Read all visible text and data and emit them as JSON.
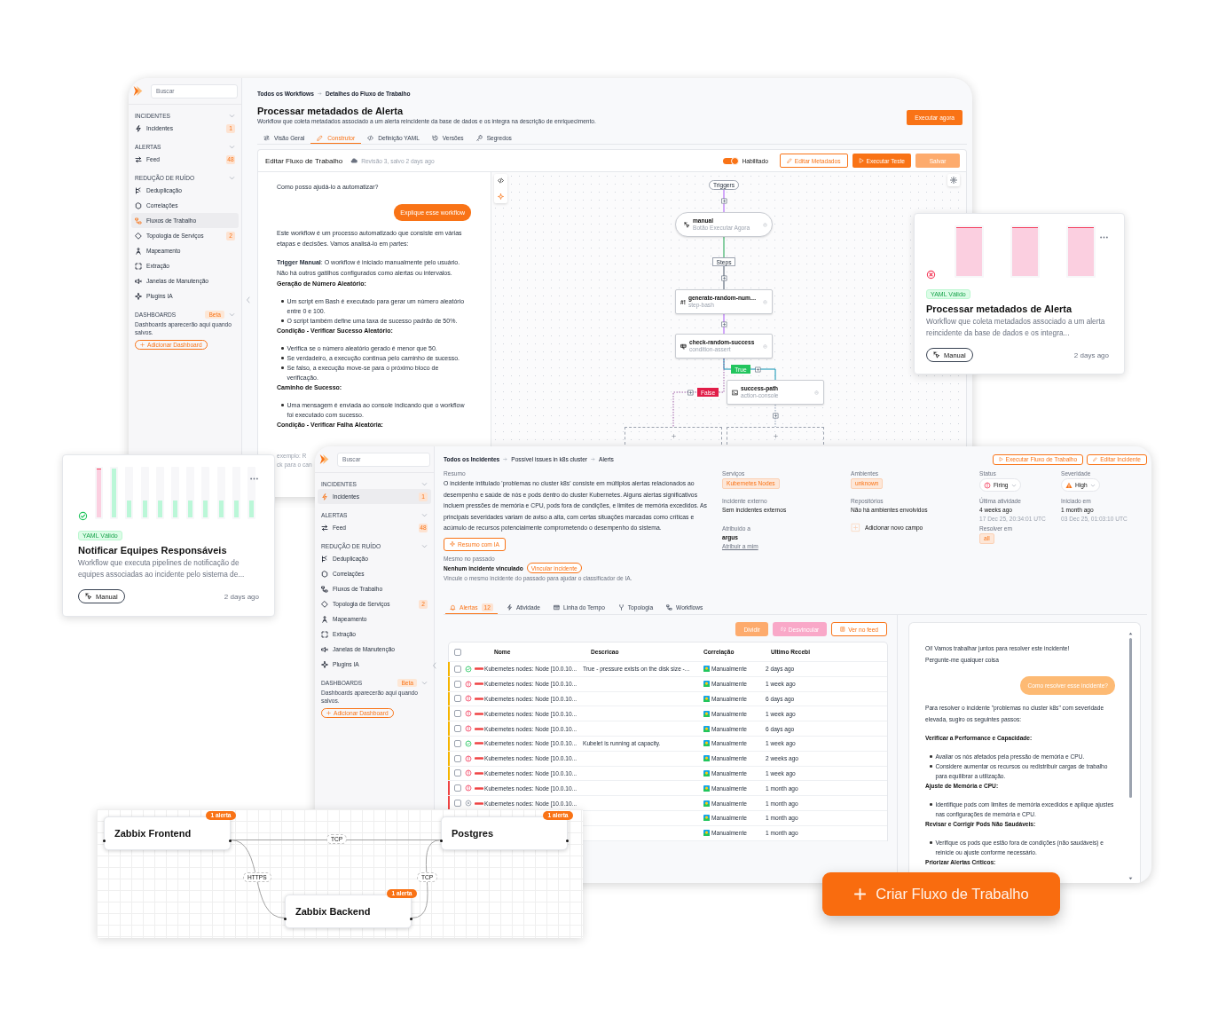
{
  "windows": [
    {
      "kind": "workflow_editor",
      "sidebar": {
        "search": {
          "placeholder": "Buscar"
        },
        "sections": [
          {
            "title": "INCIDENTES",
            "items": [
              {
                "label": "Incidentes",
                "badge": "1",
                "selected": false
              }
            ]
          },
          {
            "title": "ALERTAS",
            "items": [
              {
                "label": "Feed",
                "badge": "48",
                "selected": false
              }
            ]
          },
          {
            "title": "REDUÇÃO DE RUÍDO",
            "items": [
              {
                "label": "Deduplicação",
                "selected": false
              },
              {
                "label": "Correlações",
                "selected": false
              },
              {
                "label": "Fluxos de Trabalho",
                "selected": true
              },
              {
                "label": "Topologia de Serviços",
                "badge": "2",
                "selected": false
              },
              {
                "label": "Mapeamento",
                "selected": false
              },
              {
                "label": "Extração",
                "selected": false
              },
              {
                "label": "Janelas de Manutenção",
                "selected": false
              },
              {
                "label": "Plugins IA",
                "selected": false
              }
            ]
          },
          {
            "title": "DASHBOARDS",
            "badge": "Beta",
            "note": "Dashboards aparecerão aqui quando salvos.",
            "button": "Adicionar Dashboard"
          }
        ]
      },
      "breadcrumb": [
        "Todos os Workflows",
        "Detalhes do Fluxo de Trabalho"
      ],
      "title": "Processar metadados de Alerta",
      "description": "Workflow que coleta metadados associado a um alerta reincidente da base de dados e os integra na descrição de enriquecimento.",
      "primary_button": "Executar agora",
      "tabs": [
        {
          "label": "Visão Geral",
          "selected": false
        },
        {
          "label": "Construtor",
          "selected": true
        },
        {
          "label": "Definição YAML",
          "selected": false
        },
        {
          "label": "Versões",
          "selected": false
        },
        {
          "label": "Segredos",
          "selected": false
        }
      ],
      "editor": {
        "title": "Editar Fluxo de Trabalho",
        "revision": "Revisão 3, salvo 2 days ago",
        "toggle": {
          "label": "Habilitado",
          "on": true
        },
        "buttons": [
          {
            "label": "Editar Metadados",
            "kind": "outline"
          },
          {
            "label": "Executar Teste",
            "kind": "primary"
          },
          {
            "label": "Salvar",
            "kind": "soft"
          }
        ]
      },
      "chat": {
        "greeting": "Como posso ajudá-lo a automatizar?",
        "user_message": "Explique esse workflow",
        "reply": [
          {
            "kind": "paragraph",
            "text": "Este workflow é um processo automatizado que consiste em várias etapas e decisões. Vamos analisá-lo em partes:"
          },
          {
            "kind": "paragraph",
            "text": "**Trigger Manual**: O workflow é iniciado manualmente pelo usuário. Não há outros gatilhos configurados como alertas ou intervalos."
          },
          {
            "kind": "heading",
            "text": "Geração de Número Aleatório:"
          },
          {
            "kind": "list",
            "items": [
              "Um script em Bash é executado para gerar um número aleatório entre 0 e 100.",
              "O script também define uma taxa de sucesso padrão de 50%."
            ]
          },
          {
            "kind": "heading",
            "text": "Condição - Verificar Sucesso Aleatório:"
          },
          {
            "kind": "list",
            "items": [
              "Verifica se o número aleatório gerado é menor que 50.",
              "Se verdadeiro, a execução continua pelo caminho de sucesso.",
              "Se falso, a execução move-se para o próximo bloco de verificação."
            ]
          },
          {
            "kind": "heading",
            "text": "Caminho de Sucesso:"
          },
          {
            "kind": "list",
            "items": [
              "Uma mensagem é enviada ao console indicando que o workflow foi executado com sucesso."
            ]
          },
          {
            "kind": "heading",
            "text": "Condição - Verificar Falha Aleatória:"
          }
        ],
        "input": {
          "placeholder": "exemplo: R",
          "hint": "ck para o can"
        }
      },
      "canvas": {
        "labels": [
          {
            "text": "Triggers",
            "kind": "pill"
          },
          {
            "text": "Steps",
            "kind": "tag"
          },
          {
            "text": "True",
            "kind": "true"
          },
          {
            "text": "False",
            "kind": "false"
          }
        ],
        "nodes": [
          {
            "name": "manual",
            "type": "Botão Executar Agora",
            "kind": "trigger"
          },
          {
            "name": "generate-random-num…",
            "type": "step-bash",
            "kind": "step",
            "glyph": "#!"
          },
          {
            "name": "check-random-success",
            "type": "condition-assert",
            "kind": "condition"
          },
          {
            "name": "success-path",
            "type": "action-console",
            "kind": "action"
          }
        ]
      }
    },
    {
      "kind": "incident",
      "sidebar": {
        "search": {
          "placeholder": "Buscar"
        },
        "sections": [
          {
            "title": "INCIDENTES",
            "items": [
              {
                "label": "Incidentes",
                "badge": "1",
                "selected": true
              }
            ]
          },
          {
            "title": "ALERTAS",
            "items": [
              {
                "label": "Feed",
                "badge": "48",
                "selected": false
              }
            ]
          },
          {
            "title": "REDUÇÃO DE RUÍDO",
            "items": [
              {
                "label": "Deduplicação",
                "selected": false
              },
              {
                "label": "Correlações",
                "selected": false
              },
              {
                "label": "Fluxos de Trabalho",
                "selected": false
              },
              {
                "label": "Topologia de Serviços",
                "badge": "2",
                "selected": false
              },
              {
                "label": "Mapeamento",
                "selected": false
              },
              {
                "label": "Extração",
                "selected": false
              },
              {
                "label": "Janelas de Manutenção",
                "selected": false
              },
              {
                "label": "Plugins IA",
                "selected": false
              }
            ]
          },
          {
            "title": "DASHBOARDS",
            "badge": "Beta",
            "note": "Dashboards aparecerão aqui quando salvos.",
            "button": "Adicionar Dashboard"
          }
        ]
      },
      "breadcrumb": [
        "Todos os Incidentes",
        "Possível issues in k8s cluster",
        "Alerts"
      ],
      "header_buttons": [
        {
          "label": "Executar Fluxo de Trabalho",
          "kind": "run"
        },
        {
          "label": "Editar Incidente",
          "kind": "edit"
        }
      ],
      "summary": {
        "label": "Resumo",
        "text": "O incidente intitulado 'problemas no cluster k8s' consiste em múltiplos alertas relacionados ao desempenho e saúde de nós e pods dentro do cluster Kubernetes. Alguns alertas significativos incluem pressões de memória e CPU, pods fora de condições, e limites de memória excedidos. As principais severidades variam de aviso a alta, com certas situações marcadas como críticas e acúmulo de recursos potencialmente comprometendo o desempenho do sistema.",
        "button": "Resumo com IA"
      },
      "similar": {
        "label": "Mesmo no passado",
        "value": "Nenhum incidente vinculado",
        "button": "Vincular incidente",
        "hint": "Vincule o mesmo incidente do passado para ajudar o classificador de IA."
      },
      "details": [
        [
          {
            "kind": "tag",
            "label": "Serviços",
            "value": "Kubernetes Nodes"
          },
          {
            "kind": "text",
            "label": "Incidente externo",
            "value": "Sem incidentes externos"
          },
          {
            "kind": "assignee",
            "label": "Atribuído a",
            "value": "argus",
            "link": "Atribuir a mim"
          }
        ],
        [
          {
            "kind": "tag",
            "label": "Ambientes",
            "value": "unknown"
          },
          {
            "kind": "text",
            "label": "Repositórios",
            "value": "Não há ambientes envolvidos"
          },
          {
            "kind": "add",
            "value": "Adicionar novo campo"
          }
        ],
        [
          {
            "kind": "status",
            "label": "Status",
            "value": "Firing"
          },
          {
            "kind": "time",
            "label": "Última atividade",
            "value": "4 weeks ago",
            "detail": "17 Dec 25, 20:34:01 UTC"
          },
          {
            "kind": "tag",
            "label": "Resolver em",
            "value": "all"
          }
        ],
        [
          {
            "kind": "severity",
            "label": "Severidade",
            "value": "High"
          },
          {
            "kind": "time",
            "label": "Iniciado em",
            "value": "1 month ago",
            "detail": "03 Dec 25, 01:03:10 UTC"
          }
        ]
      ],
      "tabs": [
        {
          "label": "Alertas",
          "count": "12",
          "selected": true
        },
        {
          "label": "Atividade",
          "selected": false
        },
        {
          "label": "Linha do Tempo",
          "selected": false
        },
        {
          "label": "Topologia",
          "selected": false
        },
        {
          "label": "Workflows",
          "selected": false
        }
      ],
      "table_actions": [
        {
          "label": "Dividir",
          "kind": "soft"
        },
        {
          "label": "Desvincular",
          "kind": "pink"
        },
        {
          "label": "Ver no feed",
          "kind": "outline"
        }
      ],
      "table": {
        "checked": false,
        "columns": [
          "Nome",
          "Descricao",
          "Correlação",
          "Ultimo Recebi"
        ],
        "rows": [
          {
            "checked": false,
            "kind": "resolved",
            "color": "#f5b400",
            "name": "Kubernetes nodes: Node [10.0.10...",
            "description": "True - pressure exists on the disk size -...",
            "correlation": "Manualmente",
            "received": "2 days ago"
          },
          {
            "checked": false,
            "kind": "firing",
            "color": "#f5b400",
            "name": "Kubernetes nodes: Node [10.0.10...",
            "correlation": "Manualmente",
            "received": "1 week ago"
          },
          {
            "checked": false,
            "kind": "firing",
            "color": "#f5b400",
            "name": "Kubernetes nodes: Node [10.0.10...",
            "correlation": "Manualmente",
            "received": "6 days ago"
          },
          {
            "checked": false,
            "kind": "firing",
            "color": "#f5b400",
            "name": "Kubernetes nodes: Node [10.0.10...",
            "correlation": "Manualmente",
            "received": "1 week ago"
          },
          {
            "checked": false,
            "kind": "firing",
            "color": "#f5b400",
            "name": "Kubernetes nodes: Node [10.0.10...",
            "correlation": "Manualmente",
            "received": "6 days ago"
          },
          {
            "checked": false,
            "kind": "resolved",
            "color": "#f5b400",
            "name": "Kubernetes nodes: Node [10.0.10...",
            "description": "Kubelet is running at capacity.",
            "correlation": "Manualmente",
            "received": "1 week ago"
          },
          {
            "checked": false,
            "kind": "firing",
            "color": "#f5b400",
            "name": "Kubernetes nodes: Node [10.0.10...",
            "correlation": "Manualmente",
            "received": "2 weeks ago"
          },
          {
            "checked": false,
            "kind": "firing",
            "color": "#f5b400",
            "name": "Kubernetes nodes: Node [10.0.10...",
            "correlation": "Manualmente",
            "received": "1 week ago"
          },
          {
            "checked": false,
            "kind": "firing",
            "color": "#ef4444",
            "name": "Kubernetes nodes: Node [10.0.10...",
            "correlation": "Manualmente",
            "received": "1 month ago"
          },
          {
            "checked": false,
            "kind": "suppressed",
            "color": "#ef4444",
            "name": "Kubernetes nodes: Node [10.0.10...",
            "correlation": "Manualmente",
            "received": "1 month ago"
          },
          {
            "correlation": "Manualmente",
            "received": "1 month ago"
          },
          {
            "correlation": "Manualmente",
            "received": "1 month ago"
          }
        ]
      },
      "chat": {
        "intro": [
          "Oi! Vamos trabalhar juntos para resolver este incidente!",
          "Pergunte-me qualquer coisa"
        ],
        "user_message": "Como resolver esse incidente?",
        "reply": [
          {
            "kind": "paragraph",
            "text": "Para resolver o incidente \"problemas no cluster k8s\" com severidade elevada, sugiro os seguintes passos:"
          },
          {
            "kind": "heading",
            "text": "Verificar a Performance e Capacidade:"
          },
          {
            "kind": "list",
            "items": [
              "Avaliar os nós afetados pela pressão de memória e CPU.",
              "Considere aumentar os recursos ou redistribuir cargas de trabalho para equilibrar a utilização."
            ]
          },
          {
            "kind": "heading",
            "text": "Ajuste de Memória e CPU:"
          },
          {
            "kind": "list",
            "items": [
              "Identifique pods com limites de memória excedidos e aplique ajustes nas configurações de memória e CPU."
            ]
          },
          {
            "kind": "heading",
            "text": "Revisar e Corrigir Pods Não Saudáveis:"
          },
          {
            "kind": "list",
            "items": [
              "Verifique os pods que estão fora de condições (não saudáveis) e reinicie ou ajuste conforme necessário."
            ]
          },
          {
            "kind": "heading",
            "text": "Priorizar Alertas Críticos:"
          }
        ]
      }
    }
  ],
  "workflow_cards": [
    {
      "kind": "failed",
      "runs": [
        {
          "kind": "failed",
          "level": 1
        },
        {
          "kind": "failed",
          "level": 1
        },
        {
          "kind": "failed",
          "level": 1
        }
      ],
      "validation": "YAML Válido",
      "title": "Processar metadados de Alerta",
      "description": "Workflow que coleta metadados associado a um alerta reincidente da base de dados e os integra...",
      "trigger": "Manual",
      "updated": "2 days ago"
    },
    {
      "kind": "success",
      "runs": [
        {
          "kind": "failed",
          "level": 1
        },
        {
          "kind": "success",
          "level": 1
        },
        {
          "kind": "success",
          "level": 0.34
        },
        {
          "kind": "success",
          "level": 0.34
        },
        {
          "kind": "success",
          "level": 0.34
        },
        {
          "kind": "success",
          "level": 0.34
        },
        {
          "kind": "success",
          "level": 0.34
        },
        {
          "kind": "success",
          "level": 0.34
        },
        {
          "kind": "success",
          "level": 0.34
        },
        {
          "kind": "success",
          "level": 0.34
        },
        {
          "kind": "success",
          "level": 0.34
        }
      ],
      "validation": "YAML Válido",
      "title": "Notificar Equipes Responsáveis",
      "description": "Workflow que executa pipelines de notificação de equipes associadas ao incidente pelo sistema de...",
      "trigger": "Manual",
      "updated": "2 days ago"
    }
  ],
  "service_map": {
    "nodes": [
      {
        "name": "Zabbix Frontend",
        "badge": "1 alerta"
      },
      {
        "name": "Postgres",
        "badge": "1 alerta"
      },
      {
        "name": "Zabbix Backend",
        "badge": "1 alerta"
      }
    ],
    "edges": [
      {
        "label": "TCP"
      },
      {
        "label": "HTTPS"
      },
      {
        "label": "TCP"
      }
    ]
  },
  "create_button": {
    "label": "Criar Fluxo de Trabalho"
  }
}
